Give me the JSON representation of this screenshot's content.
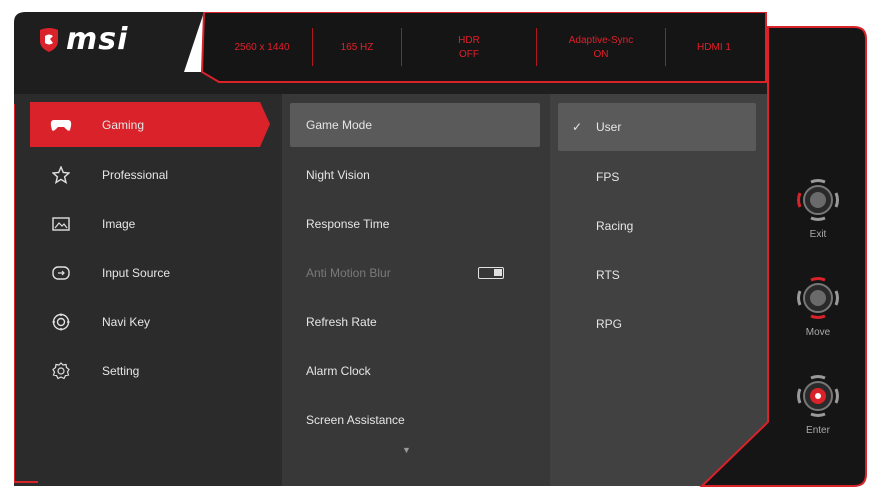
{
  "brand": {
    "name": "msi"
  },
  "status_bar": [
    {
      "line1": "2560 x 1440",
      "line2": ""
    },
    {
      "line1": "165 HZ",
      "line2": ""
    },
    {
      "line1": "HDR",
      "line2": "OFF"
    },
    {
      "line1": "Adaptive-Sync",
      "line2": "ON"
    },
    {
      "line1": "HDMI 1",
      "line2": ""
    }
  ],
  "sidebar": {
    "items": [
      {
        "label": "Gaming",
        "icon": "gamepad-icon",
        "active": true
      },
      {
        "label": "Professional",
        "icon": "star-icon",
        "active": false
      },
      {
        "label": "Image",
        "icon": "image-icon",
        "active": false
      },
      {
        "label": "Input Source",
        "icon": "input-source-icon",
        "active": false
      },
      {
        "label": "Navi Key",
        "icon": "navi-key-icon",
        "active": false
      },
      {
        "label": "Setting",
        "icon": "gear-icon",
        "active": false
      }
    ]
  },
  "submenu": {
    "items": [
      {
        "label": "Game Mode",
        "selected": true,
        "disabled": false
      },
      {
        "label": "Night Vision",
        "selected": false,
        "disabled": false
      },
      {
        "label": "Response Time",
        "selected": false,
        "disabled": false
      },
      {
        "label": "Anti Motion Blur",
        "selected": false,
        "disabled": true,
        "toggle": "on"
      },
      {
        "label": "Refresh Rate",
        "selected": false,
        "disabled": false
      },
      {
        "label": "Alarm Clock",
        "selected": false,
        "disabled": false
      },
      {
        "label": "Screen Assistance",
        "selected": false,
        "disabled": false
      }
    ],
    "more_indicator": "▼"
  },
  "options": {
    "check": "✓",
    "items": [
      {
        "label": "User",
        "selected": true
      },
      {
        "label": "FPS",
        "selected": false
      },
      {
        "label": "Racing",
        "selected": false
      },
      {
        "label": "RTS",
        "selected": false
      },
      {
        "label": "RPG",
        "selected": false
      }
    ]
  },
  "controls": [
    {
      "label": "Exit",
      "icon": "joystick-left-icon"
    },
    {
      "label": "Move",
      "icon": "joystick-updown-icon"
    },
    {
      "label": "Enter",
      "icon": "joystick-press-icon"
    }
  ],
  "colors": {
    "accent": "#d9222a",
    "panel_dark": "#2a2a2a",
    "panel_mid": "#363636",
    "panel_light": "#414141",
    "selected": "#5a5a5a"
  }
}
